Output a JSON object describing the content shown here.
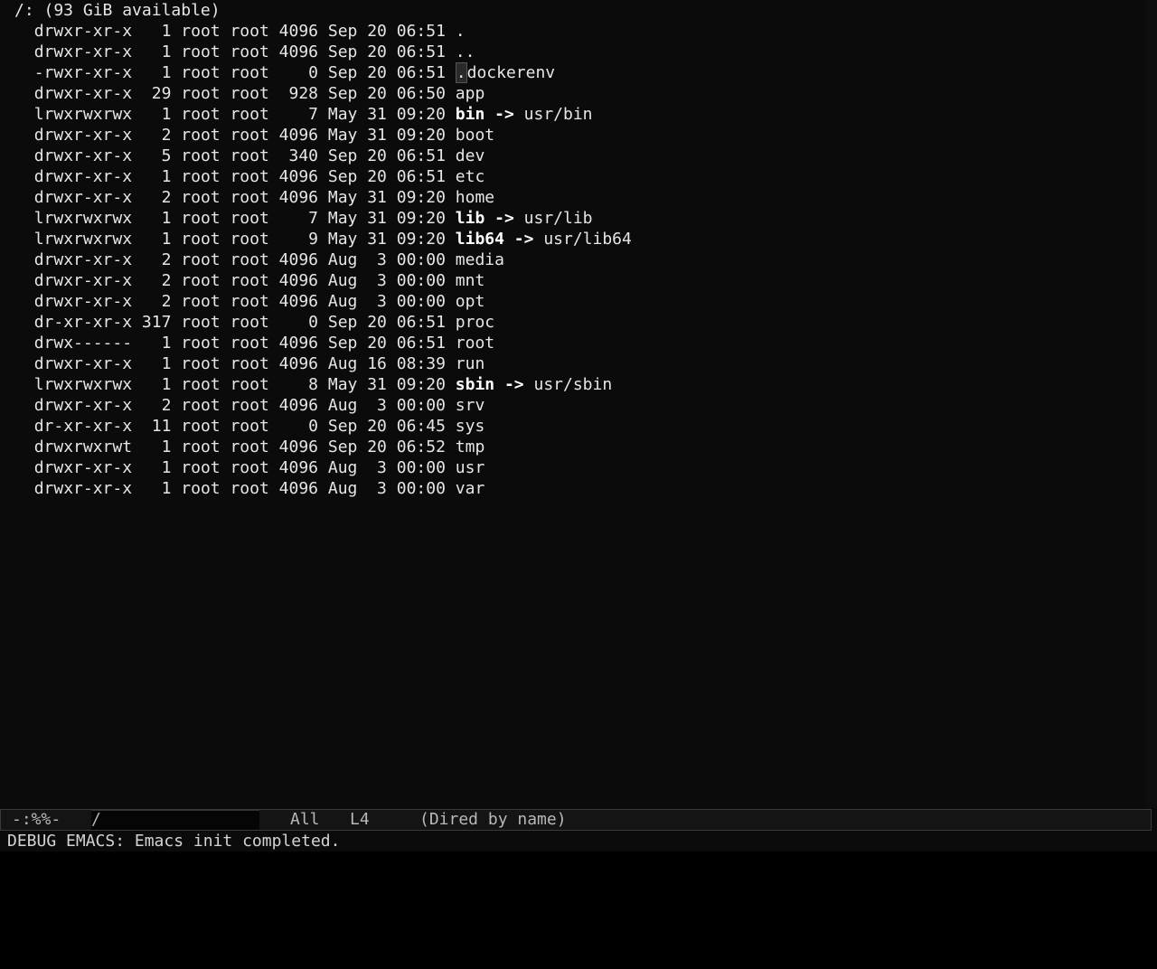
{
  "dired": {
    "header": "/: (93 GiB available)",
    "entries": [
      {
        "perms": "drwxr-xr-x",
        "links": "1",
        "owner": "root",
        "group": "root",
        "size": "4096",
        "date": "Sep 20 06:51",
        "name": ".",
        "target": ""
      },
      {
        "perms": "drwxr-xr-x",
        "links": "1",
        "owner": "root",
        "group": "root",
        "size": "4096",
        "date": "Sep 20 06:51",
        "name": "..",
        "target": ""
      },
      {
        "perms": "-rwxr-xr-x",
        "links": "1",
        "owner": "root",
        "group": "root",
        "size": "0",
        "date": "Sep 20 06:51",
        "name": ".dockerenv",
        "target": ""
      },
      {
        "perms": "drwxr-xr-x",
        "links": "29",
        "owner": "root",
        "group": "root",
        "size": "928",
        "date": "Sep 20 06:50",
        "name": "app",
        "target": ""
      },
      {
        "perms": "lrwxrwxrwx",
        "links": "1",
        "owner": "root",
        "group": "root",
        "size": "7",
        "date": "May 31 09:20",
        "name": "bin",
        "target": "usr/bin"
      },
      {
        "perms": "drwxr-xr-x",
        "links": "2",
        "owner": "root",
        "group": "root",
        "size": "4096",
        "date": "May 31 09:20",
        "name": "boot",
        "target": ""
      },
      {
        "perms": "drwxr-xr-x",
        "links": "5",
        "owner": "root",
        "group": "root",
        "size": "340",
        "date": "Sep 20 06:51",
        "name": "dev",
        "target": ""
      },
      {
        "perms": "drwxr-xr-x",
        "links": "1",
        "owner": "root",
        "group": "root",
        "size": "4096",
        "date": "Sep 20 06:51",
        "name": "etc",
        "target": ""
      },
      {
        "perms": "drwxr-xr-x",
        "links": "2",
        "owner": "root",
        "group": "root",
        "size": "4096",
        "date": "May 31 09:20",
        "name": "home",
        "target": ""
      },
      {
        "perms": "lrwxrwxrwx",
        "links": "1",
        "owner": "root",
        "group": "root",
        "size": "7",
        "date": "May 31 09:20",
        "name": "lib",
        "target": "usr/lib"
      },
      {
        "perms": "lrwxrwxrwx",
        "links": "1",
        "owner": "root",
        "group": "root",
        "size": "9",
        "date": "May 31 09:20",
        "name": "lib64",
        "target": "usr/lib64"
      },
      {
        "perms": "drwxr-xr-x",
        "links": "2",
        "owner": "root",
        "group": "root",
        "size": "4096",
        "date": "Aug  3 00:00",
        "name": "media",
        "target": ""
      },
      {
        "perms": "drwxr-xr-x",
        "links": "2",
        "owner": "root",
        "group": "root",
        "size": "4096",
        "date": "Aug  3 00:00",
        "name": "mnt",
        "target": ""
      },
      {
        "perms": "drwxr-xr-x",
        "links": "2",
        "owner": "root",
        "group": "root",
        "size": "4096",
        "date": "Aug  3 00:00",
        "name": "opt",
        "target": ""
      },
      {
        "perms": "dr-xr-xr-x",
        "links": "317",
        "owner": "root",
        "group": "root",
        "size": "0",
        "date": "Sep 20 06:51",
        "name": "proc",
        "target": ""
      },
      {
        "perms": "drwx------",
        "links": "1",
        "owner": "root",
        "group": "root",
        "size": "4096",
        "date": "Sep 20 06:51",
        "name": "root",
        "target": ""
      },
      {
        "perms": "drwxr-xr-x",
        "links": "1",
        "owner": "root",
        "group": "root",
        "size": "4096",
        "date": "Aug 16 08:39",
        "name": "run",
        "target": ""
      },
      {
        "perms": "lrwxrwxrwx",
        "links": "1",
        "owner": "root",
        "group": "root",
        "size": "8",
        "date": "May 31 09:20",
        "name": "sbin",
        "target": "usr/sbin"
      },
      {
        "perms": "drwxr-xr-x",
        "links": "2",
        "owner": "root",
        "group": "root",
        "size": "4096",
        "date": "Aug  3 00:00",
        "name": "srv",
        "target": ""
      },
      {
        "perms": "dr-xr-xr-x",
        "links": "11",
        "owner": "root",
        "group": "root",
        "size": "0",
        "date": "Sep 20 06:45",
        "name": "sys",
        "target": ""
      },
      {
        "perms": "drwxrwxrwt",
        "links": "1",
        "owner": "root",
        "group": "root",
        "size": "4096",
        "date": "Sep 20 06:52",
        "name": "tmp",
        "target": ""
      },
      {
        "perms": "drwxr-xr-x",
        "links": "1",
        "owner": "root",
        "group": "root",
        "size": "4096",
        "date": "Aug  3 00:00",
        "name": "usr",
        "target": ""
      },
      {
        "perms": "drwxr-xr-x",
        "links": "1",
        "owner": "root",
        "group": "root",
        "size": "4096",
        "date": "Aug  3 00:00",
        "name": "var",
        "target": ""
      }
    ]
  },
  "mode_line": {
    "status": "-:%%-",
    "buffer_name": "/",
    "position": "All",
    "line": "L4",
    "mode": "(Dired by name)"
  },
  "echo_area": {
    "message": "DEBUG EMACS: Emacs init completed."
  },
  "colors": {
    "background": "#0b0b0b",
    "foreground": "#e6e6e6",
    "symlink_name": "#ffffff",
    "mode_line_bg": "#141414"
  }
}
